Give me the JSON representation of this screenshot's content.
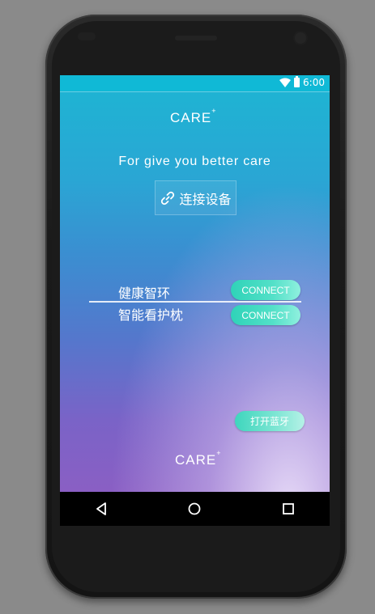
{
  "status_bar": {
    "time": "6:00",
    "wifi_icon": "wifi-icon",
    "battery_icon": "battery-icon",
    "color": "#10b9d6"
  },
  "header": {
    "logo_text": "CARE",
    "logo_mark": "+"
  },
  "tagline": "For give you better care",
  "connect_device": {
    "icon": "link-icon",
    "label": "连接设备"
  },
  "devices": [
    {
      "name": "健康智环",
      "button": "CONNECT"
    },
    {
      "name": "智能看护枕",
      "button": "CONNECT"
    }
  ],
  "bluetooth_button": "打开蓝牙",
  "footer": {
    "logo_text": "CARE",
    "logo_mark": "+"
  },
  "nav": {
    "back": "back-icon",
    "home": "home-icon",
    "recents": "recents-icon"
  }
}
